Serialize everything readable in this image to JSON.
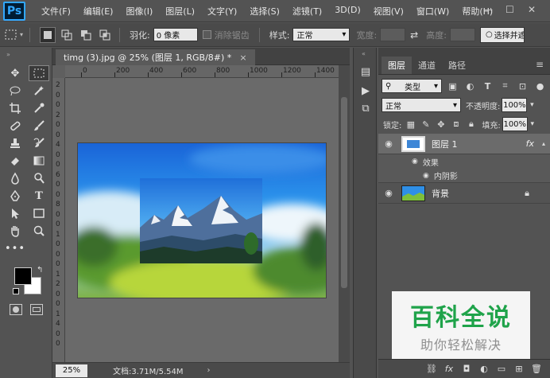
{
  "app": {
    "logo": "Ps"
  },
  "menu": [
    "文件(F)",
    "编辑(E)",
    "图像(I)",
    "图层(L)",
    "文字(Y)",
    "选择(S)",
    "滤镜(T)",
    "3D(D)",
    "视图(V)",
    "窗口(W)",
    "帮助(H)"
  ],
  "window_controls": {
    "minimize": "—",
    "maximize": "☐",
    "close": "✕"
  },
  "options": {
    "feather_label": "羽化:",
    "feather_value": "0 像素",
    "antialias_label": "消除锯齿",
    "style_label": "样式:",
    "style_value": "正常",
    "width_label": "宽度:",
    "height_label": "高度:",
    "select_mask_button": "选择并遮"
  },
  "document": {
    "tab_title": "timg (3).jpg @ 25% (图层 1, RGB/8#) *",
    "zoom": "25%",
    "doc_info": "文档:3.71M/5.54M"
  },
  "rulers": {
    "horizontal": [
      "0",
      "200",
      "400",
      "600",
      "800",
      "1000",
      "1200",
      "1400"
    ],
    "vertical": [
      "2",
      "0",
      "0",
      "2",
      "0",
      "0",
      "4",
      "0",
      "0",
      "6",
      "0",
      "0",
      "8",
      "0",
      "0",
      "1",
      "0",
      "0",
      "0",
      "1",
      "2",
      "0",
      "0",
      "1",
      "4",
      "0",
      "0"
    ]
  },
  "layers_panel": {
    "tabs": [
      "图层",
      "通道",
      "路径"
    ],
    "filter_kind": "类型",
    "blend_mode": "正常",
    "opacity_label": "不透明度:",
    "opacity_value": "100%",
    "lock_label": "锁定:",
    "fill_label": "填充:",
    "fill_value": "100%",
    "layers": [
      {
        "name": "图层 1",
        "fx": "fx",
        "effects_label": "效果",
        "effect": "内阴影"
      },
      {
        "name": "背景"
      }
    ]
  },
  "watermark": {
    "title": "百科全说",
    "subtitle": "助你轻松解决"
  }
}
